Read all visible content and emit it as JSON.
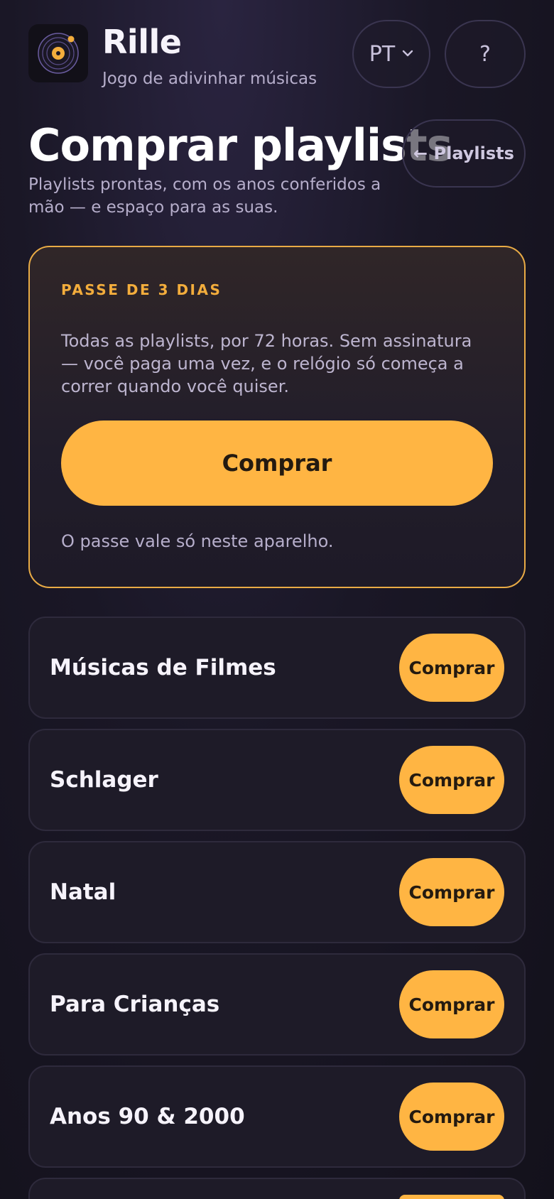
{
  "app": {
    "title": "Rille",
    "subtitle": "Jogo de adivinhar músicas"
  },
  "header": {
    "language": "PT",
    "help_label": "?"
  },
  "page": {
    "title": "Comprar playlists",
    "description": "Playlists prontas, com os anos conferidos a mão — e espaço para as suas.",
    "back_label": "← Playlists"
  },
  "pass": {
    "eyebrow": "PASSE DE 3 DIAS",
    "description": "Todas as playlists, por 72 horas. Sem assinatura — você paga uma vez, e o relógio só começa a correr quando você quiser.",
    "buy_label": "Comprar",
    "note": "O passe vale só neste aparelho."
  },
  "playlists": [
    {
      "name": "Músicas de Filmes",
      "buy_label": "Comprar"
    },
    {
      "name": "Schlager",
      "buy_label": "Comprar"
    },
    {
      "name": "Natal",
      "buy_label": "Comprar"
    },
    {
      "name": "Para Crianças",
      "buy_label": "Comprar"
    },
    {
      "name": "Anos 90 & 2000",
      "buy_label": "Comprar"
    },
    {
      "name": "",
      "buy_label": ""
    }
  ],
  "colors": {
    "accent": "#ffb543",
    "accent_text": "#f3ad3c",
    "background": "#1a1726",
    "card": "#1e1b28"
  }
}
